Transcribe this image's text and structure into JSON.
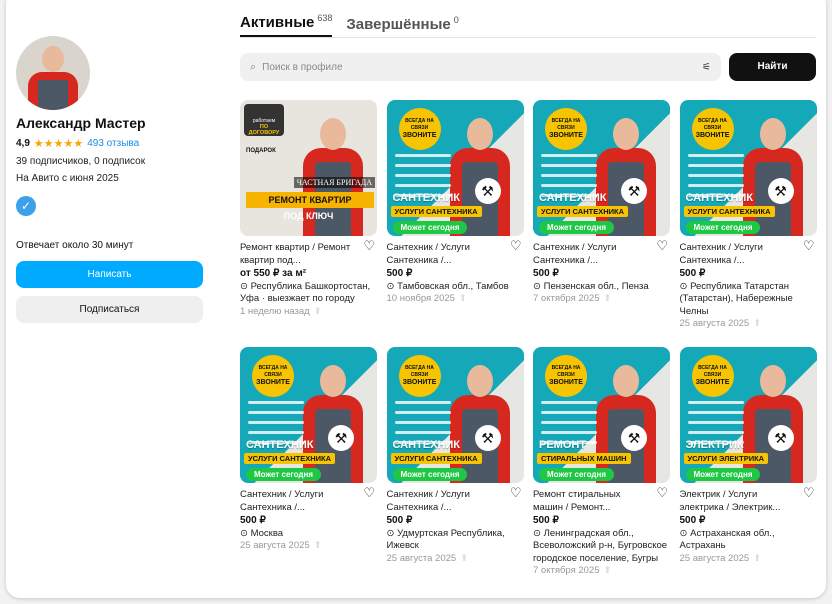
{
  "profile": {
    "name": "Александр Мастер",
    "rating": "4,9",
    "stars": "★★★★★",
    "reviews": "493 отзыва",
    "subscribers": "39 подписчиков, 0 подписок",
    "since": "На Авито с июня 2025",
    "verified_icon": "check-badge-icon",
    "reply_time": "Отвечает около 30 минут",
    "write_label": "Написать",
    "subscribe_label": "Подписаться"
  },
  "tabs": [
    {
      "label": "Активные",
      "count": "638"
    },
    {
      "label": "Завершённые",
      "count": "0"
    }
  ],
  "search": {
    "placeholder": "Поиск в профиле",
    "button": "Найти"
  },
  "banner_first": {
    "contract_top": "работаем",
    "contract": "ПО ДОГОВОРУ",
    "gift": "ПОДАРОК",
    "brigade": "ЧАСТНАЯ БРИГАДА",
    "headline": "РЕМОНТ КВАРТИР",
    "sub": "ПОД КЛЮЧ"
  },
  "banner_common": {
    "bubble_top": "ВСЕГДА НА СВЯЗИ",
    "bubble_main": "ЗВОНИТЕ",
    "pill": "Может сегодня"
  },
  "listings": [
    {
      "headline": "",
      "sub": "",
      "title": "Ремонт квартир / Ремонт квартир под...",
      "price": "от 550 ₽ за м²",
      "location": "Республика Башкортостан, Уфа · выезжает по городу",
      "date": "1 неделю назад"
    },
    {
      "headline": "САНТЕХНИК",
      "sub": "УСЛУГИ САНТЕХНИКА",
      "title": "Сантехник / Услуги Сантехника /...",
      "price": "500 ₽",
      "location": "Тамбовская обл., Тамбов",
      "date": "10 ноября 2025"
    },
    {
      "headline": "САНТЕХНИК",
      "sub": "УСЛУГИ САНТЕХНИКА",
      "title": "Сантехник / Услуги Сантехника /...",
      "price": "500 ₽",
      "location": "Пензенская обл., Пенза",
      "date": "7 октября 2025"
    },
    {
      "headline": "САНТЕХНИК",
      "sub": "УСЛУГИ САНТЕХНИКА",
      "title": "Сантехник / Услуги Сантехника /...",
      "price": "500 ₽",
      "location": "Республика Татарстан (Татарстан), Набережные Челны",
      "date": "25 августа 2025"
    },
    {
      "headline": "САНТЕХНИК",
      "sub": "УСЛУГИ САНТЕХНИКА",
      "title": "Сантехник / Услуги Сантехника /...",
      "price": "500 ₽",
      "location": "Москва",
      "date": "25 августа 2025"
    },
    {
      "headline": "САНТЕХНИК",
      "sub": "УСЛУГИ САНТЕХНИКА",
      "title": "Сантехник / Услуги Сантехника /...",
      "price": "500 ₽",
      "location": "Удмуртская Республика, Ижевск",
      "date": "25 августа 2025"
    },
    {
      "headline": "РЕМОНТ",
      "sub": "СТИРАЛЬНЫХ МАШИН",
      "title": "Ремонт стиральных машин / Ремонт...",
      "price": "500 ₽",
      "location": "Ленинградская обл., Всеволожский р-н, Бугровское городское поселение, Бугры",
      "date": "7 октября 2025"
    },
    {
      "headline": "ЭЛЕКТРИК",
      "sub": "УСЛУГИ ЭЛЕКТРИКА",
      "title": "Электрик / Услуги электрика / Электрик...",
      "price": "500 ₽",
      "location": "Астраханская обл., Астрахань",
      "date": "25 августа 2025"
    }
  ]
}
